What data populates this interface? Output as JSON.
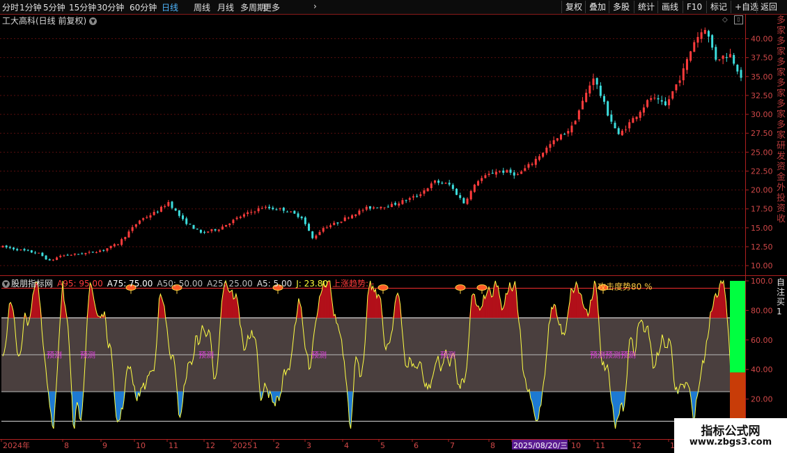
{
  "toolbar": {
    "periods": [
      "分时",
      "1分钟",
      "5分钟",
      "15分钟",
      "30分钟",
      "60分钟",
      "日线",
      "周线",
      "月线",
      "多周期",
      "更多"
    ],
    "active_period": "日线",
    "more_icon": "chevron-right-icon",
    "right_buttons": [
      "复权",
      "叠加",
      "多股",
      "统计",
      "画线",
      "F10",
      "标记",
      "+自选",
      "返回"
    ]
  },
  "main": {
    "title": "工大高科(日线 前复权)",
    "title_icon": "chevron-down-icon",
    "price_axis": [
      "40.00",
      "37.50",
      "35.00",
      "32.50",
      "30.00",
      "27.50",
      "25.00",
      "22.50",
      "20.00",
      "17.50",
      "15.00",
      "12.50",
      "10.00"
    ],
    "side_text": "多家多家多家多家多家多家研发资金外投资收"
  },
  "indicator": {
    "name": "股朋指标网",
    "fields": [
      {
        "label": "A95: 95.00",
        "color": "#ff3b3b"
      },
      {
        "label": "A75: 75.00",
        "color": "#ffffff"
      },
      {
        "label": "A50: 50.00",
        "color": "#bcbcbc"
      },
      {
        "label": "A25: 25.00",
        "color": "#bcbcbc"
      },
      {
        "label": "A5: 5.00",
        "color": "#e0e0e0"
      },
      {
        "label": "J: 23.80",
        "color": "#ffff3b"
      },
      {
        "label": "上涨趋势: -",
        "color": "#ff3b3b"
      }
    ],
    "axis": [
      "100.0",
      "80.00",
      "60.00",
      "40.00",
      "20.00"
    ],
    "annotation": "攻击度势80 %",
    "marker_label": "预测",
    "side_text": "自注买1"
  },
  "dates": [
    "2024年",
    "8",
    "9",
    "10",
    "11",
    "12",
    "2025",
    "1",
    "2",
    "3",
    "4",
    "5",
    "6",
    "7",
    "8",
    "2025/08/20/三",
    "10",
    "11",
    "12",
    "1"
  ],
  "watermark": {
    "title": "指标公式网",
    "url": "www.zbgs3.com"
  },
  "colors": {
    "up": "#ff3c3c",
    "down": "#3cdcdc",
    "line": "#ffff44",
    "fill_high": "#b2101a",
    "fill_low": "#1e7ad2",
    "zone": "#4a3f3e",
    "bar_green": "#00ff40",
    "bar_orange": "#c83c08"
  },
  "chart_data": {
    "type": "line",
    "price_range": [
      9.0,
      41.8
    ],
    "price_path": [
      [
        0,
        12.5
      ],
      [
        10,
        11.6
      ],
      [
        13,
        10.6
      ],
      [
        16,
        11.3
      ],
      [
        20,
        11.5
      ],
      [
        24,
        11.7
      ],
      [
        28,
        12.1
      ],
      [
        32,
        12.9
      ],
      [
        38,
        16.0
      ],
      [
        43,
        17.2
      ],
      [
        46,
        18.4
      ],
      [
        50,
        16.0
      ],
      [
        55,
        14.3
      ],
      [
        60,
        14.9
      ],
      [
        66,
        16.5
      ],
      [
        72,
        17.7
      ],
      [
        78,
        17.4
      ],
      [
        83,
        16.4
      ],
      [
        86,
        13.6
      ],
      [
        89,
        15.0
      ],
      [
        93,
        15.7
      ],
      [
        96,
        16.5
      ],
      [
        101,
        17.6
      ],
      [
        108,
        18.0
      ],
      [
        115,
        19.2
      ],
      [
        120,
        21.1
      ],
      [
        124,
        20.7
      ],
      [
        128,
        18.3
      ],
      [
        132,
        21.3
      ],
      [
        137,
        22.5
      ],
      [
        140,
        22.4
      ],
      [
        143,
        22.0
      ],
      [
        147,
        23.6
      ],
      [
        152,
        26.0
      ],
      [
        158,
        28.3
      ],
      [
        164,
        35.0
      ],
      [
        168,
        30.1
      ],
      [
        171,
        27.2
      ],
      [
        175,
        29.4
      ],
      [
        180,
        32.2
      ],
      [
        184,
        31.1
      ],
      [
        189,
        35.8
      ],
      [
        192,
        39.7
      ],
      [
        195,
        41.5
      ],
      [
        198,
        37.4
      ],
      [
        202,
        37.9
      ],
      [
        205,
        35.1
      ]
    ],
    "indicator_levels": [
      95,
      75,
      50,
      25,
      5
    ],
    "j_last": 23.8
  }
}
